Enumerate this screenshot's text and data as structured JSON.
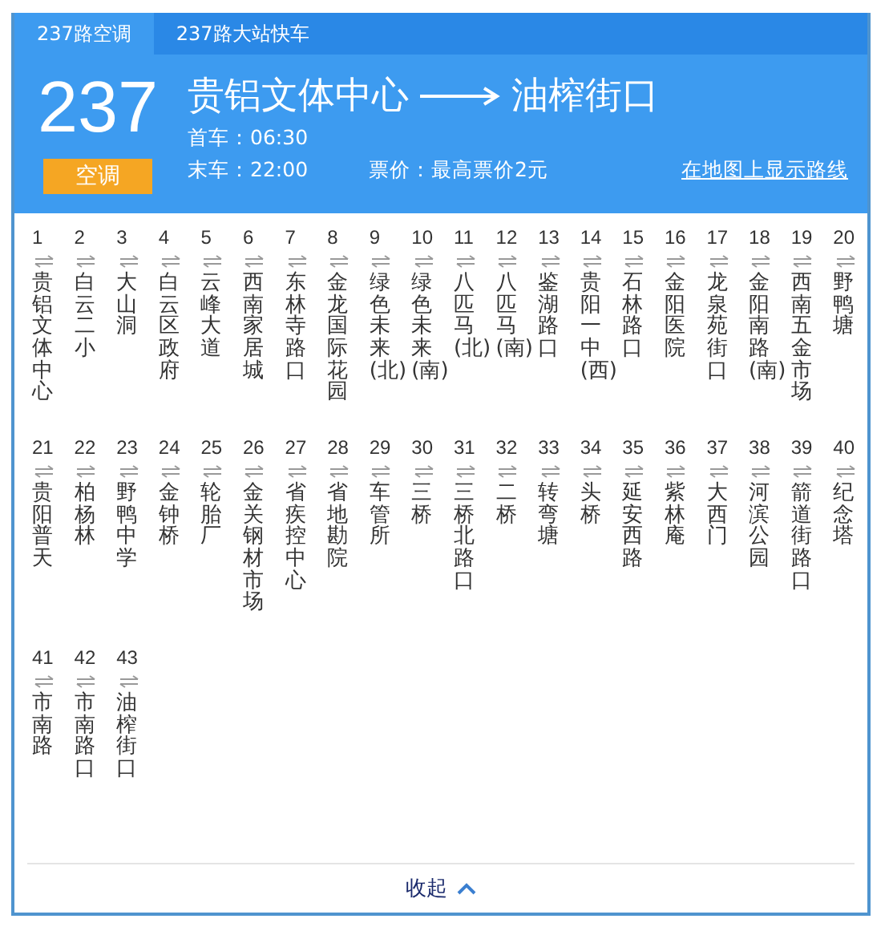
{
  "tabs": [
    {
      "label": "237路空调",
      "selected": true
    },
    {
      "label": "237路大站快车",
      "selected": false
    }
  ],
  "route": {
    "number": "237",
    "badge": "空调",
    "origin": "贵铝文体中心",
    "destination": "油榨街口",
    "first_bus": "首车：06:30",
    "last_bus": "末车：22:00",
    "fare": "票价：最高票价2元",
    "map_link": "在地图上显示路线"
  },
  "stops": [
    {
      "number": "1",
      "name": "贵铝文体中心"
    },
    {
      "number": "2",
      "name": "白云二小"
    },
    {
      "number": "3",
      "name": "大山洞"
    },
    {
      "number": "4",
      "name": "白云区政府"
    },
    {
      "number": "5",
      "name": "云峰大道"
    },
    {
      "number": "6",
      "name": "西南家居城"
    },
    {
      "number": "7",
      "name": "东林寺路口"
    },
    {
      "number": "8",
      "name": "金龙国际花园"
    },
    {
      "number": "9",
      "name": "绿色未来(北)"
    },
    {
      "number": "10",
      "name": "绿色未来(南)"
    },
    {
      "number": "11",
      "name": "八匹马(北)"
    },
    {
      "number": "12",
      "name": "八匹马(南)"
    },
    {
      "number": "13",
      "name": "鉴湖路口"
    },
    {
      "number": "14",
      "name": "贵阳一中(西)"
    },
    {
      "number": "15",
      "name": "石林路口"
    },
    {
      "number": "16",
      "name": "金阳医院"
    },
    {
      "number": "17",
      "name": "龙泉苑街口"
    },
    {
      "number": "18",
      "name": "金阳南路(南)"
    },
    {
      "number": "19",
      "name": "西南五金市场"
    },
    {
      "number": "20",
      "name": "野鸭塘"
    },
    {
      "number": "21",
      "name": "贵阳普天"
    },
    {
      "number": "22",
      "name": "柏杨林"
    },
    {
      "number": "23",
      "name": "野鸭中学"
    },
    {
      "number": "24",
      "name": "金钟桥"
    },
    {
      "number": "25",
      "name": "轮胎厂"
    },
    {
      "number": "26",
      "name": "金关钢材市场"
    },
    {
      "number": "27",
      "name": "省疾控中心"
    },
    {
      "number": "28",
      "name": "省地勘院"
    },
    {
      "number": "29",
      "name": "车管所"
    },
    {
      "number": "30",
      "name": "三桥"
    },
    {
      "number": "31",
      "name": "三桥北路口"
    },
    {
      "number": "32",
      "name": "二桥"
    },
    {
      "number": "33",
      "name": "转弯塘"
    },
    {
      "number": "34",
      "name": "头桥"
    },
    {
      "number": "35",
      "name": "延安西路"
    },
    {
      "number": "36",
      "name": "紫林庵"
    },
    {
      "number": "37",
      "name": "大西门"
    },
    {
      "number": "38",
      "name": "河滨公园"
    },
    {
      "number": "39",
      "name": "箭道街路口"
    },
    {
      "number": "40",
      "name": "纪念塔"
    },
    {
      "number": "41",
      "name": "市南路"
    },
    {
      "number": "42",
      "name": "市南路口"
    },
    {
      "number": "43",
      "name": "油榨街口"
    }
  ],
  "collapse_label": "收起"
}
